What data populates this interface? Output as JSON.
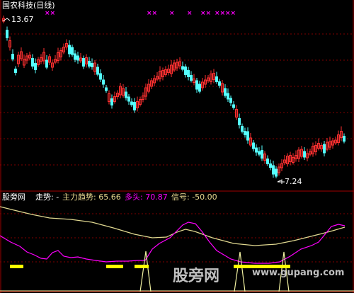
{
  "chart": {
    "title": "国农科技(日线)",
    "high_label": "13.67",
    "low_label": "7.24"
  },
  "indicator": {
    "name": "股旁网",
    "trend_label": "走势: -",
    "main_label": "主力趋势: 65.66",
    "long_label": "多头: 70.87",
    "signal_label": "信号: -50.00"
  },
  "watermark": {
    "text": "股旁网",
    "url": "www.gupang.com"
  },
  "colors": {
    "background": "#000000",
    "up_candle": "#ff3030",
    "down_candle": "#54ffff",
    "grid": "#800000",
    "cross_markers": "#ff00ff",
    "main_trend_line": "#e0d890",
    "long_line": "#ff00ff",
    "signal_spikes": "#f0f0a0",
    "highlight_bars": "#ffff00"
  },
  "icons": [
    "cross-marker-icon"
  ]
}
